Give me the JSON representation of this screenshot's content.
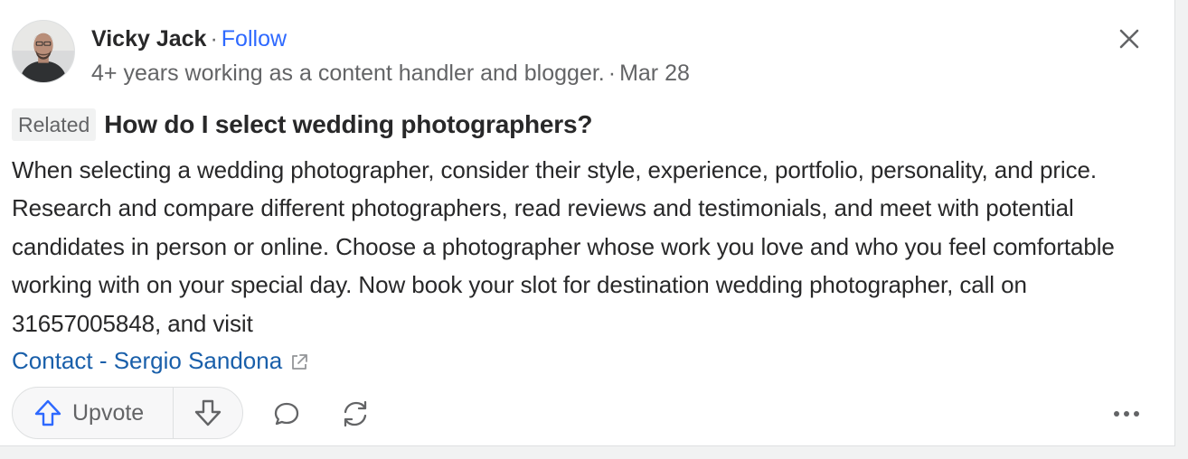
{
  "author": {
    "name": "Vicky Jack",
    "separator": "·",
    "follow_label": "Follow",
    "credential": "4+ years working as a content handler and blogger.",
    "date_separator": "·",
    "date": "Mar 28"
  },
  "question": {
    "badge": "Related",
    "title": "How do I select wedding photographers?"
  },
  "answer": {
    "text": "When selecting a wedding photographer, consider their style, experience, portfolio, personality, and price. Research and compare different photographers, read reviews and testimonials, and meet with potential candidates in person or online. Choose a photographer whose work you love and who you feel comfortable working with on your special day. Now book your slot for destination wedding photographer, call on 31657005848, and visit",
    "link_text": "Contact - Sergio Sandona"
  },
  "actions": {
    "upvote_label": "Upvote"
  },
  "colors": {
    "accent": "#2e69ff",
    "link": "#195faa",
    "text": "#282829",
    "muted": "#636466"
  },
  "icons": [
    "close-icon",
    "external-link-icon",
    "upvote-arrow-icon",
    "downvote-arrow-icon",
    "comment-icon",
    "share-icon",
    "more-icon"
  ]
}
